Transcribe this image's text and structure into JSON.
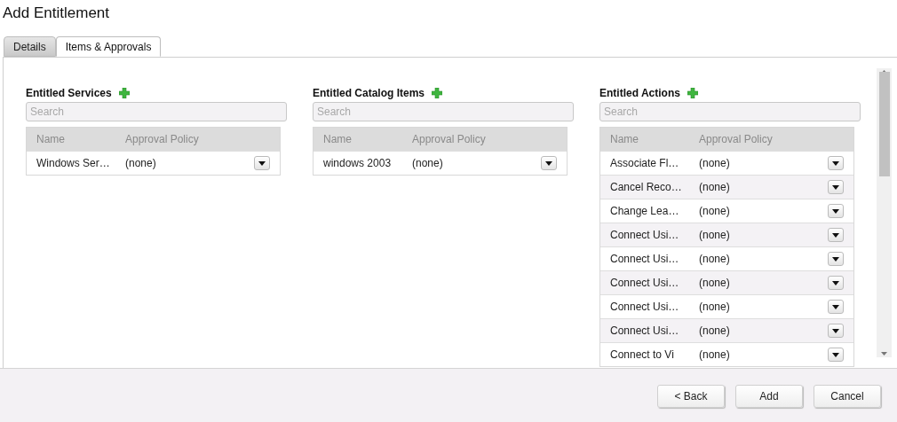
{
  "window": {
    "title": "Add Entitlement"
  },
  "tabs": [
    {
      "label": "Details",
      "selected": false
    },
    {
      "label": "Items & Approvals",
      "selected": true
    }
  ],
  "sections": [
    {
      "title": "Entitled Services",
      "search": {
        "placeholder": "Search"
      },
      "columns": [
        "Name",
        "Approval Policy"
      ],
      "rows": [
        {
          "name": "Windows Ser…",
          "policy": "(none)"
        }
      ]
    },
    {
      "title": "Entitled Catalog Items",
      "search": {
        "placeholder": "Search"
      },
      "columns": [
        "Name",
        "Approval Policy"
      ],
      "rows": [
        {
          "name": "windows 2003",
          "policy": "(none)"
        }
      ]
    },
    {
      "title": "Entitled Actions",
      "search": {
        "placeholder": "Search"
      },
      "columns": [
        "Name",
        "Approval Policy"
      ],
      "rows": [
        {
          "name": "Associate Fl…",
          "policy": "(none)"
        },
        {
          "name": "Cancel Reco…",
          "policy": "(none)"
        },
        {
          "name": "Change Lea…",
          "policy": "(none)"
        },
        {
          "name": "Connect Usi…",
          "policy": "(none)"
        },
        {
          "name": "Connect Usi…",
          "policy": "(none)"
        },
        {
          "name": "Connect Usi…",
          "policy": "(none)"
        },
        {
          "name": "Connect Usi…",
          "policy": "(none)"
        },
        {
          "name": "Connect Usi…",
          "policy": "(none)"
        },
        {
          "name": "Connect to Vi",
          "policy": "(none)"
        }
      ]
    }
  ],
  "buttons": [
    "< Back",
    "Add",
    "Cancel"
  ]
}
